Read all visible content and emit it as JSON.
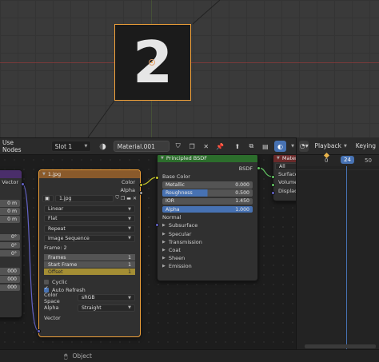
{
  "viewport": {
    "object_label": "2"
  },
  "node_header": {
    "menu": "Use Nodes",
    "slot": "Slot 1",
    "material": "Material.001"
  },
  "image_node": {
    "title": "1.jpg",
    "outputs": [
      "Color",
      "Alpha"
    ],
    "image_name": "1.jpg",
    "interpolation": "Linear",
    "projection": "Flat",
    "extension": "Repeat",
    "source": "Image Sequence",
    "frame_info": "Frame: 2",
    "frames": {
      "label": "Frames",
      "value": "1"
    },
    "start_frame": {
      "label": "Start Frame",
      "value": "1"
    },
    "offset": {
      "label": "Offset",
      "value": "1"
    },
    "cyclic": "Cyclic",
    "auto_refresh": "Auto Refresh",
    "color_space": {
      "label": "Color Space",
      "value": "sRGB"
    },
    "alpha": {
      "label": "Alpha",
      "value": "Straight"
    },
    "vector_input": "Vector"
  },
  "bsdf_node": {
    "title": "Principled BSDF",
    "output": "BSDF",
    "base_color": "Base Color",
    "metallic": {
      "label": "Metallic",
      "value": "0.000"
    },
    "roughness": {
      "label": "Roughness",
      "value": "0.500",
      "fraction": 0.5
    },
    "ior": {
      "label": "IOR",
      "value": "1.450"
    },
    "alpha": {
      "label": "Alpha",
      "value": "1.000"
    },
    "normal": "Normal",
    "panels": [
      "Subsurface",
      "Specular",
      "Transmission",
      "Coat",
      "Sheen",
      "Emission"
    ]
  },
  "output_node": {
    "title": "Mater",
    "target": "All",
    "inputs": [
      "Surface",
      "Volume",
      "Displacer"
    ]
  },
  "left_node": {
    "vector": "Vector",
    "values": [
      "0 m",
      "0 m",
      "0 m",
      "0°",
      "0°",
      "0°",
      "000",
      "000",
      "000"
    ]
  },
  "timeline": {
    "playback": "Playback",
    "keying": "Keying",
    "frames": [
      "0",
      "50"
    ],
    "current_frame": "24"
  },
  "statusbar": {
    "object": "Object"
  },
  "colors": {
    "accent": "#4772b3",
    "selection": "#f0a13a",
    "image_node_header": "#8a5a2b",
    "bsdf_header": "#2c6e2c",
    "output_header": "#6a2a2a"
  }
}
